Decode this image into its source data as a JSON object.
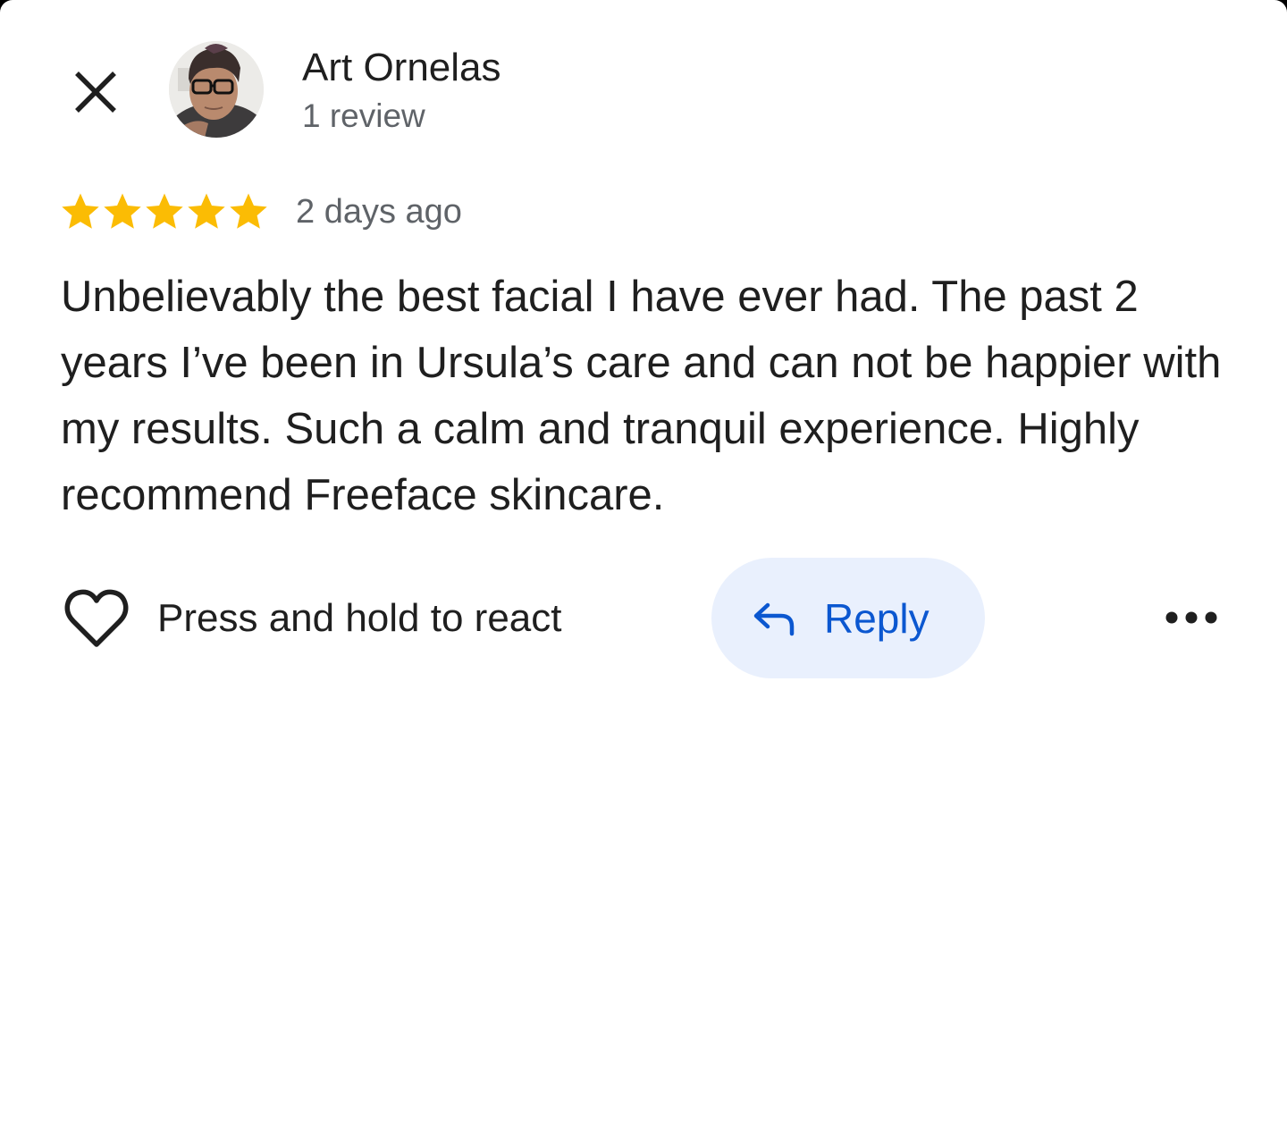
{
  "review": {
    "author_name": "Art Ornelas",
    "review_count": "1 review",
    "rating": 5,
    "rating_max": 5,
    "date": "2 days ago",
    "body": "Unbelievably the best facial I have ever had. The past 2 years I’ve been in Ursula’s care and can not be happier with my results. Such a calm and tranquil experience. Highly recommend Freeface skincare."
  },
  "actions": {
    "react_label": "Press and hold to react",
    "reply_label": "Reply"
  },
  "icons": {
    "close": "close-icon",
    "avatar": "avatar",
    "star": "star-icon",
    "heart": "heart-icon",
    "reply": "reply-arrow-icon",
    "more": "more-horizontal-icon"
  },
  "colors": {
    "star": "#fbbc04",
    "reply_text": "#0b57d0",
    "reply_background": "#e9f0fd",
    "secondary_text": "#5f6368",
    "primary_text": "#1f1f1f"
  }
}
